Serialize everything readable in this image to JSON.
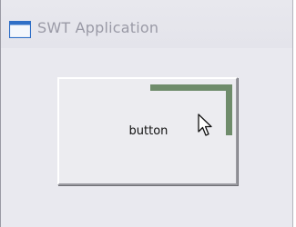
{
  "window": {
    "title": "SWT Application",
    "icon": "window-app-icon"
  },
  "main": {
    "button_label": "button"
  },
  "cursor": {
    "icon": "arrow-pointer-icon"
  },
  "colors": {
    "window_background": "#e8e8ee",
    "title_text": "#9a9aa6",
    "button_face": "#ececf0",
    "paint_overlay": "#6f8c6b"
  }
}
